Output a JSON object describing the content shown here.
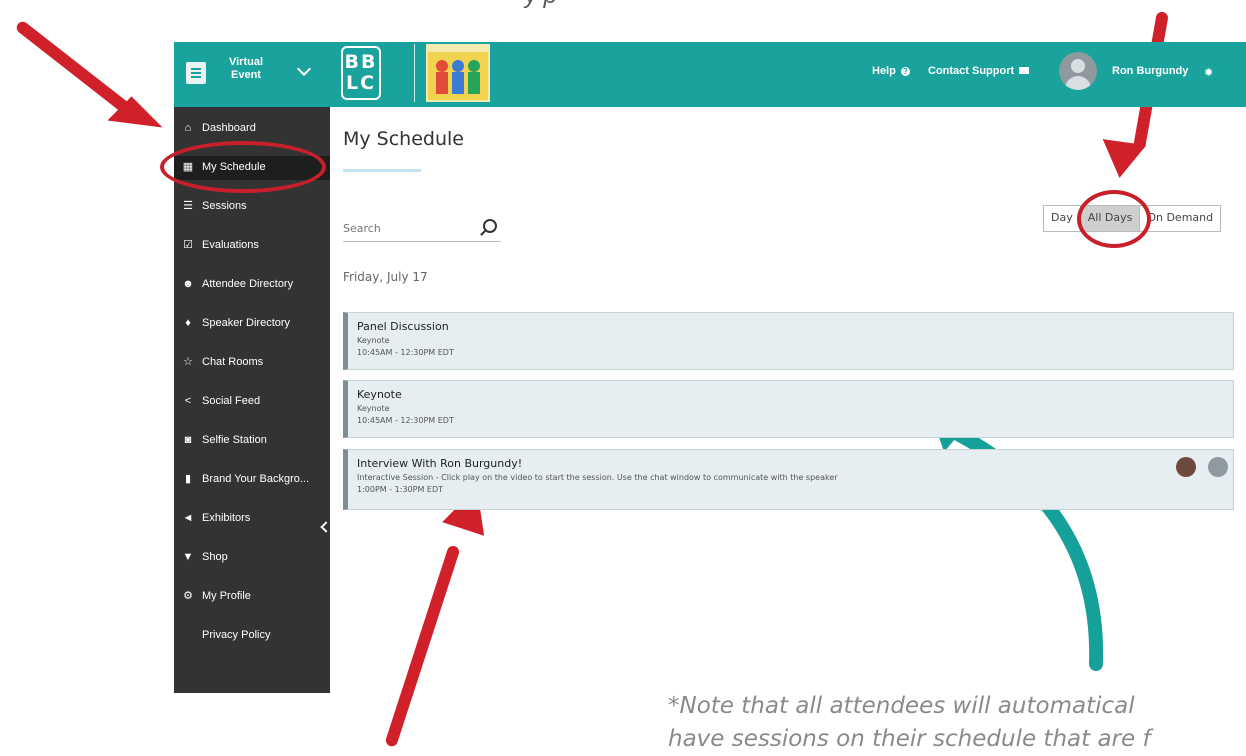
{
  "header": {
    "event_label": "Virtual Event",
    "logo_text": "BB LC",
    "help": "Help",
    "contact": "Contact Support",
    "user": "Ron Burgundy"
  },
  "sidebar": {
    "items": [
      {
        "icon": "home-icon",
        "label": "Dashboard"
      },
      {
        "icon": "calendar-icon",
        "label": "My Schedule"
      },
      {
        "icon": "list-icon",
        "label": "Sessions"
      },
      {
        "icon": "checkbox-icon",
        "label": "Evaluations"
      },
      {
        "icon": "people-icon",
        "label": "Attendee Directory"
      },
      {
        "icon": "microphone-icon",
        "label": "Speaker Directory"
      },
      {
        "icon": "star-icon",
        "label": "Chat Rooms"
      },
      {
        "icon": "share-icon",
        "label": "Social Feed"
      },
      {
        "icon": "camera-icon",
        "label": "Selfie Station"
      },
      {
        "icon": "film-icon",
        "label": "Brand Your Backgro..."
      },
      {
        "icon": "megaphone-icon",
        "label": "Exhibitors"
      },
      {
        "icon": "cart-icon",
        "label": "Shop"
      },
      {
        "icon": "gear-icon",
        "label": "My Profile"
      },
      {
        "icon": "",
        "label": "Privacy Policy"
      }
    ]
  },
  "main": {
    "title": "My Schedule",
    "search_placeholder": "Search",
    "views": [
      "Day",
      "All Days",
      "On Demand"
    ],
    "selected_view": "All Days",
    "day_heading": "Friday, July 17",
    "sessions": [
      {
        "title": "Panel Discussion",
        "type": "Keynote",
        "time": "10:45AM - 12:30PM EDT"
      },
      {
        "title": "Keynote",
        "type": "Keynote",
        "time": "10:45AM - 12:30PM EDT"
      },
      {
        "title": "Interview With Ron Burgundy!",
        "type": "Interactive Session - Click play on the video to start the session. Use the chat window to communicate with the speaker",
        "time": "1:00PM - 1:30PM EDT"
      }
    ]
  },
  "annotation": {
    "note_line1": "*Note that all attendees will automatical",
    "note_line2": "have sessions on their schedule that are f",
    "arrow_color": "#d0202a",
    "teal_arrow_color": "#16a09a"
  }
}
